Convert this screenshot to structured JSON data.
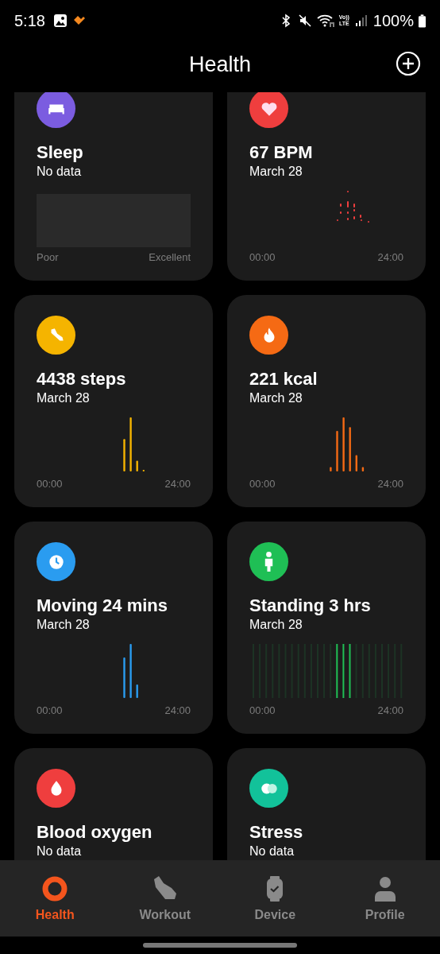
{
  "status_bar": {
    "time": "5:18",
    "network_top": "Vo))",
    "network_bottom": "LTE",
    "battery": "100%"
  },
  "header": {
    "title": "Health"
  },
  "cards": [
    {
      "color": "#7b5ce0",
      "title": "Sleep",
      "subtitle": "No data",
      "chart": {
        "kind": "scale",
        "left": "Poor",
        "right": "Excellent"
      }
    },
    {
      "color": "#ef3e3e",
      "title": "67 BPM",
      "subtitle": "March 28",
      "chart": {
        "kind": "dots",
        "left": "00:00",
        "right": "24:00"
      }
    },
    {
      "color": "#f5b400",
      "title": "4438 steps",
      "subtitle": "March 28",
      "chart": {
        "kind": "bars",
        "left": "00:00",
        "right": "24:00"
      }
    },
    {
      "color": "#f56a14",
      "title": "221 kcal",
      "subtitle": "March 28",
      "chart": {
        "kind": "bars",
        "left": "00:00",
        "right": "24:00"
      }
    },
    {
      "color": "#2a9cf0",
      "title": "Moving 24 mins",
      "subtitle": "March 28",
      "chart": {
        "kind": "bars",
        "left": "00:00",
        "right": "24:00"
      }
    },
    {
      "color": "#1fbf55",
      "title": "Standing 3 hrs",
      "subtitle": "March 28",
      "chart": {
        "kind": "standing",
        "left": "00:00",
        "right": "24:00"
      }
    },
    {
      "color": "#ef3e3e",
      "title": "Blood oxygen",
      "subtitle": "No data"
    },
    {
      "color": "#12c29a",
      "title": "Stress",
      "subtitle": "No data"
    }
  ],
  "nav": [
    {
      "label": "Health",
      "selected": true
    },
    {
      "label": "Workout",
      "selected": false
    },
    {
      "label": "Device",
      "selected": false
    },
    {
      "label": "Profile",
      "selected": false
    }
  ]
}
